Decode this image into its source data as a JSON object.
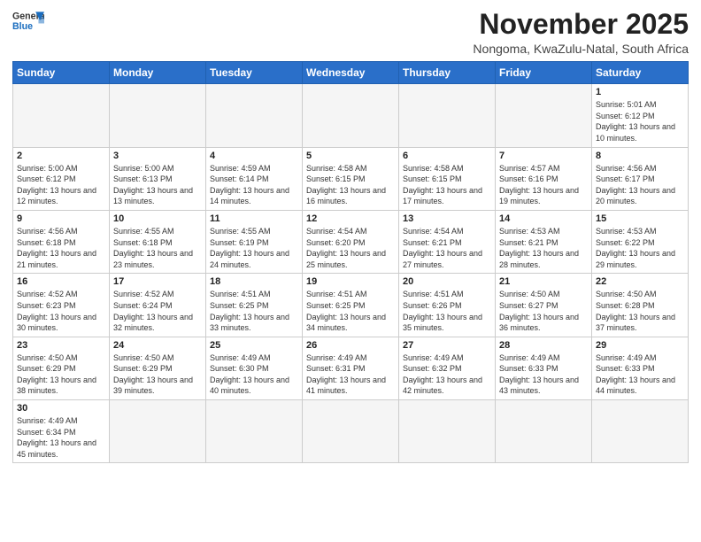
{
  "header": {
    "logo_general": "General",
    "logo_blue": "Blue",
    "month_title": "November 2025",
    "subtitle": "Nongoma, KwaZulu-Natal, South Africa"
  },
  "weekdays": [
    "Sunday",
    "Monday",
    "Tuesday",
    "Wednesday",
    "Thursday",
    "Friday",
    "Saturday"
  ],
  "weeks": [
    [
      {
        "day": "",
        "info": ""
      },
      {
        "day": "",
        "info": ""
      },
      {
        "day": "",
        "info": ""
      },
      {
        "day": "",
        "info": ""
      },
      {
        "day": "",
        "info": ""
      },
      {
        "day": "",
        "info": ""
      },
      {
        "day": "1",
        "info": "Sunrise: 5:01 AM\nSunset: 6:12 PM\nDaylight: 13 hours and 10 minutes."
      }
    ],
    [
      {
        "day": "2",
        "info": "Sunrise: 5:00 AM\nSunset: 6:12 PM\nDaylight: 13 hours and 12 minutes."
      },
      {
        "day": "3",
        "info": "Sunrise: 5:00 AM\nSunset: 6:13 PM\nDaylight: 13 hours and 13 minutes."
      },
      {
        "day": "4",
        "info": "Sunrise: 4:59 AM\nSunset: 6:14 PM\nDaylight: 13 hours and 14 minutes."
      },
      {
        "day": "5",
        "info": "Sunrise: 4:58 AM\nSunset: 6:15 PM\nDaylight: 13 hours and 16 minutes."
      },
      {
        "day": "6",
        "info": "Sunrise: 4:58 AM\nSunset: 6:15 PM\nDaylight: 13 hours and 17 minutes."
      },
      {
        "day": "7",
        "info": "Sunrise: 4:57 AM\nSunset: 6:16 PM\nDaylight: 13 hours and 19 minutes."
      },
      {
        "day": "8",
        "info": "Sunrise: 4:56 AM\nSunset: 6:17 PM\nDaylight: 13 hours and 20 minutes."
      }
    ],
    [
      {
        "day": "9",
        "info": "Sunrise: 4:56 AM\nSunset: 6:18 PM\nDaylight: 13 hours and 21 minutes."
      },
      {
        "day": "10",
        "info": "Sunrise: 4:55 AM\nSunset: 6:18 PM\nDaylight: 13 hours and 23 minutes."
      },
      {
        "day": "11",
        "info": "Sunrise: 4:55 AM\nSunset: 6:19 PM\nDaylight: 13 hours and 24 minutes."
      },
      {
        "day": "12",
        "info": "Sunrise: 4:54 AM\nSunset: 6:20 PM\nDaylight: 13 hours and 25 minutes."
      },
      {
        "day": "13",
        "info": "Sunrise: 4:54 AM\nSunset: 6:21 PM\nDaylight: 13 hours and 27 minutes."
      },
      {
        "day": "14",
        "info": "Sunrise: 4:53 AM\nSunset: 6:21 PM\nDaylight: 13 hours and 28 minutes."
      },
      {
        "day": "15",
        "info": "Sunrise: 4:53 AM\nSunset: 6:22 PM\nDaylight: 13 hours and 29 minutes."
      }
    ],
    [
      {
        "day": "16",
        "info": "Sunrise: 4:52 AM\nSunset: 6:23 PM\nDaylight: 13 hours and 30 minutes."
      },
      {
        "day": "17",
        "info": "Sunrise: 4:52 AM\nSunset: 6:24 PM\nDaylight: 13 hours and 32 minutes."
      },
      {
        "day": "18",
        "info": "Sunrise: 4:51 AM\nSunset: 6:25 PM\nDaylight: 13 hours and 33 minutes."
      },
      {
        "day": "19",
        "info": "Sunrise: 4:51 AM\nSunset: 6:25 PM\nDaylight: 13 hours and 34 minutes."
      },
      {
        "day": "20",
        "info": "Sunrise: 4:51 AM\nSunset: 6:26 PM\nDaylight: 13 hours and 35 minutes."
      },
      {
        "day": "21",
        "info": "Sunrise: 4:50 AM\nSunset: 6:27 PM\nDaylight: 13 hours and 36 minutes."
      },
      {
        "day": "22",
        "info": "Sunrise: 4:50 AM\nSunset: 6:28 PM\nDaylight: 13 hours and 37 minutes."
      }
    ],
    [
      {
        "day": "23",
        "info": "Sunrise: 4:50 AM\nSunset: 6:29 PM\nDaylight: 13 hours and 38 minutes."
      },
      {
        "day": "24",
        "info": "Sunrise: 4:50 AM\nSunset: 6:29 PM\nDaylight: 13 hours and 39 minutes."
      },
      {
        "day": "25",
        "info": "Sunrise: 4:49 AM\nSunset: 6:30 PM\nDaylight: 13 hours and 40 minutes."
      },
      {
        "day": "26",
        "info": "Sunrise: 4:49 AM\nSunset: 6:31 PM\nDaylight: 13 hours and 41 minutes."
      },
      {
        "day": "27",
        "info": "Sunrise: 4:49 AM\nSunset: 6:32 PM\nDaylight: 13 hours and 42 minutes."
      },
      {
        "day": "28",
        "info": "Sunrise: 4:49 AM\nSunset: 6:33 PM\nDaylight: 13 hours and 43 minutes."
      },
      {
        "day": "29",
        "info": "Sunrise: 4:49 AM\nSunset: 6:33 PM\nDaylight: 13 hours and 44 minutes."
      }
    ],
    [
      {
        "day": "30",
        "info": "Sunrise: 4:49 AM\nSunset: 6:34 PM\nDaylight: 13 hours and 45 minutes."
      },
      {
        "day": "",
        "info": ""
      },
      {
        "day": "",
        "info": ""
      },
      {
        "day": "",
        "info": ""
      },
      {
        "day": "",
        "info": ""
      },
      {
        "day": "",
        "info": ""
      },
      {
        "day": "",
        "info": ""
      }
    ]
  ]
}
